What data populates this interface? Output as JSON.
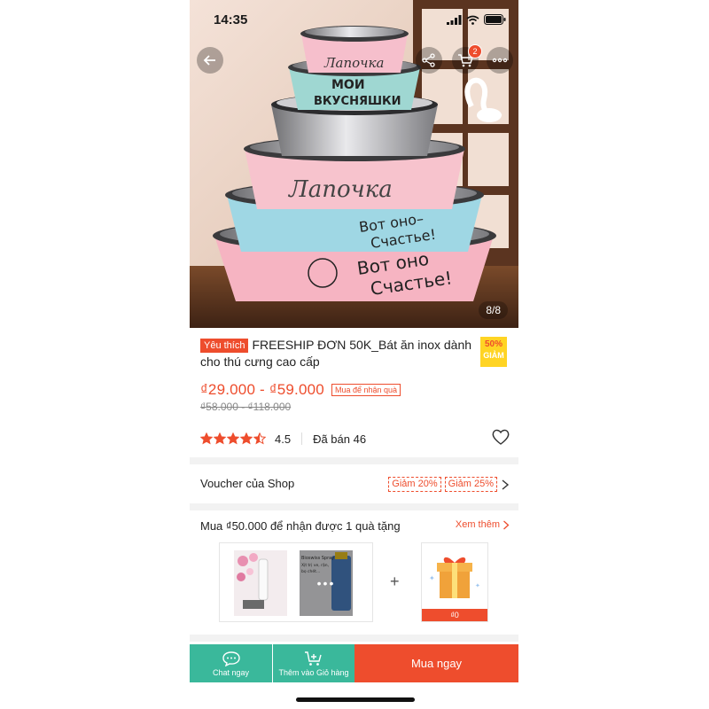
{
  "status": {
    "time": "14:35"
  },
  "header": {
    "cart_count": "2"
  },
  "gallery": {
    "indicator": "8/8"
  },
  "product": {
    "badge": "Yêu thích",
    "title": "FREESHIP ĐƠN 50K_Bát ăn inox dành cho thú cưng cao cấp",
    "discount_pct": "50%",
    "discount_label": "GIẢM",
    "price_range": "₫29.000 - ₫59.000",
    "gift_tag": "Mua để nhận quà",
    "old_price_range": "₫58.000 - ₫118.000",
    "rating": "4.5",
    "rating_value": 4.5,
    "sold": "Đã bán 46"
  },
  "voucher": {
    "label": "Voucher của Shop",
    "chips": [
      "Giảm 20%",
      "Giảm 25%"
    ]
  },
  "gift": {
    "heading": "Mua ₫50.000 để nhận được 1 quà tặng",
    "see_more": "Xem thêm",
    "more_dots": "•••",
    "plus": "+",
    "gift_price": "₫0"
  },
  "bottom_bar": {
    "chat": "Chat ngay",
    "add_cart": "Thêm vào Giỏ hàng",
    "buy_now": "Mua ngay"
  },
  "colors": {
    "accent": "#ee4d2d",
    "teal": "#3ab89b",
    "yellow": "#ffd424"
  },
  "images": {
    "hero_bowls": [
      "Лапочка",
      "МОИ",
      "ВКУСНЯШКИ",
      "Лапочка",
      "Вот оно–",
      "Счастье!",
      "Вот оно",
      "Счастье!"
    ],
    "spray_bottle": [
      "Bioswiss Spray",
      "Xịt trị ve, rận,",
      "bọ chét..."
    ]
  }
}
